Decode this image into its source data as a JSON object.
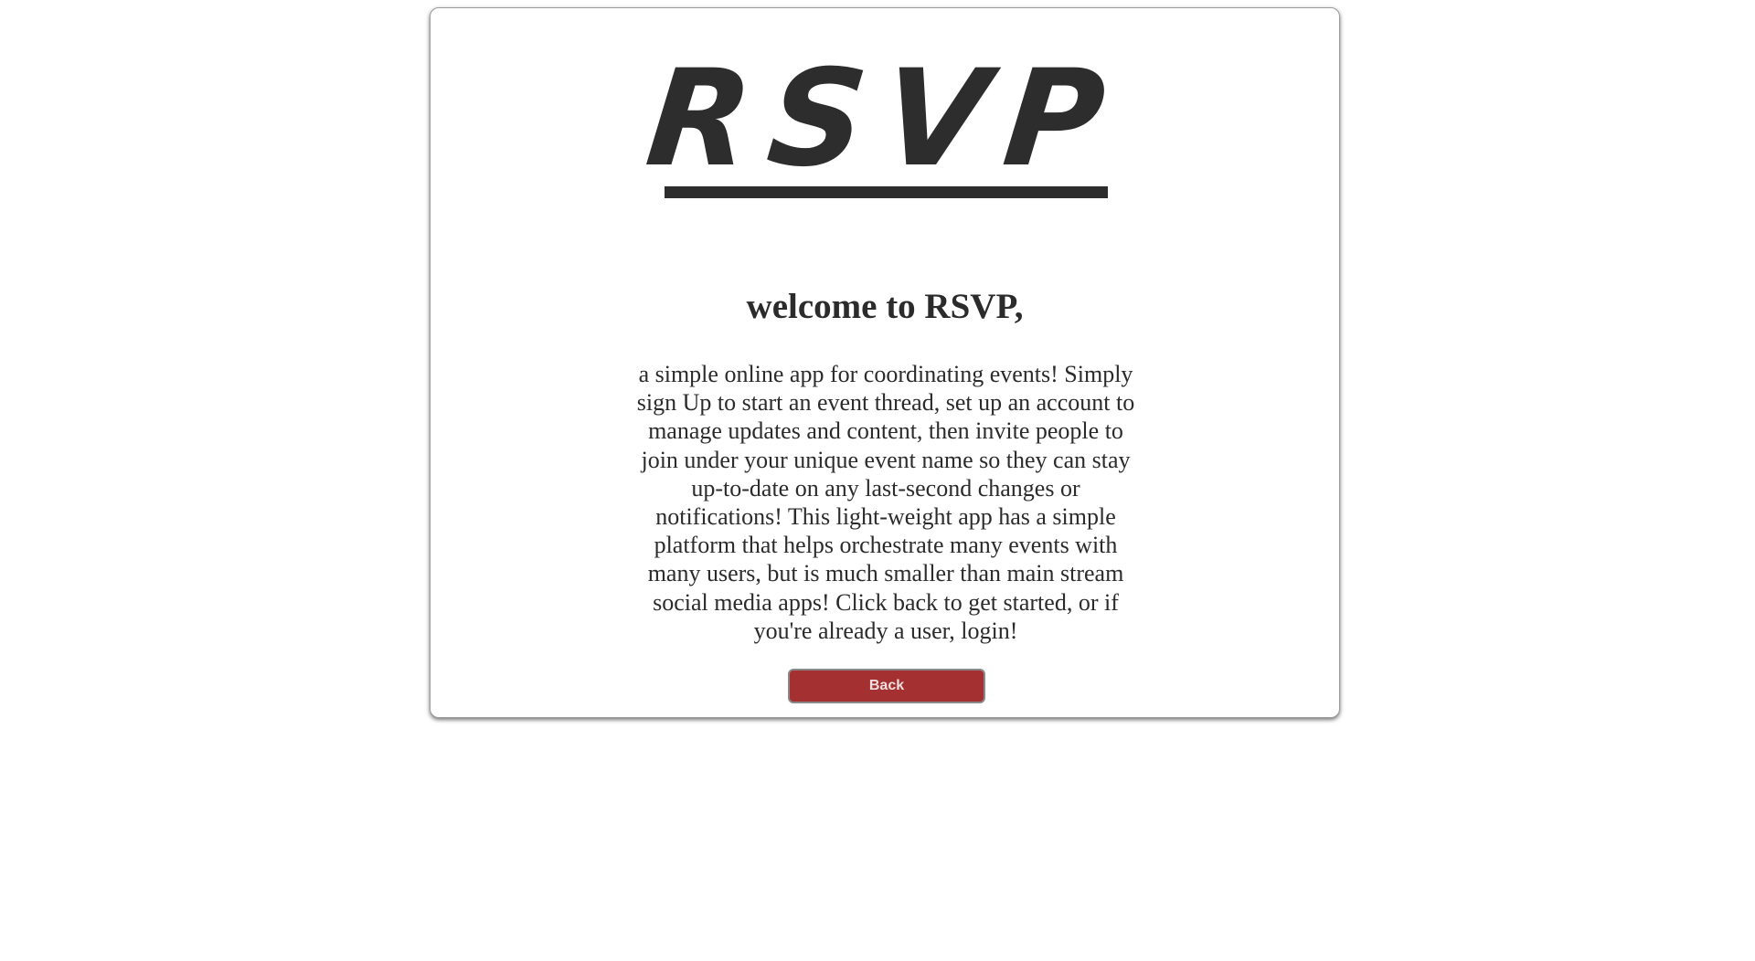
{
  "header": {
    "logo_text": "RSVP"
  },
  "main": {
    "welcome_heading": "welcome to RSVP,",
    "description": "a simple online app for coordinating events! Simply sign Up to start an event thread, set up an account to manage updates and content, then invite people to join under your unique event name so they can stay up-to-date on any last-second changes or notifications! This light-weight app has a simple platform that helps orchestrate many events with many users, but is much smaller than main stream social media apps! Click back to get started, or if you're already a user, login!",
    "back_button_label": "Back"
  },
  "colors": {
    "text": "#2b2b2b",
    "button_background": "#a53032",
    "button_text": "#f1dede",
    "card_border": "#9a9a9a"
  }
}
